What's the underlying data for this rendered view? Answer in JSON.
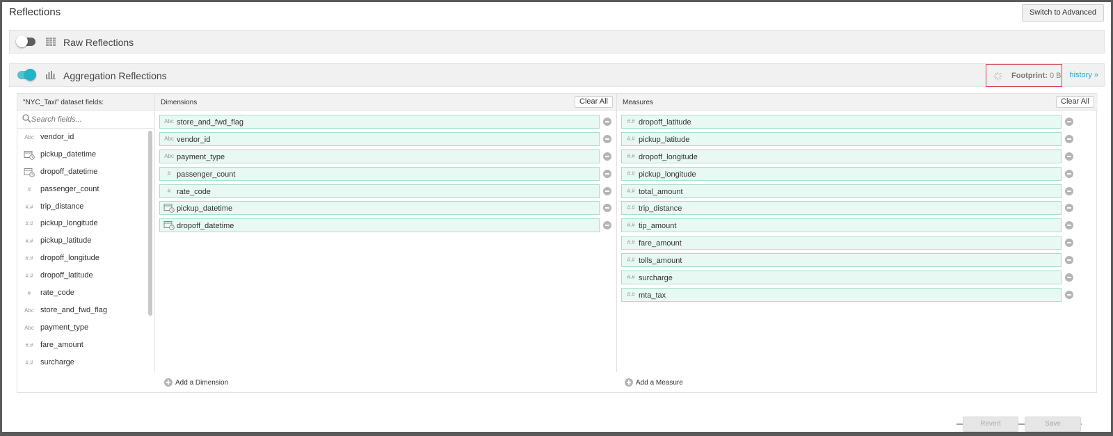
{
  "page": {
    "title": "Reflections",
    "switch_label": "Switch to Advanced"
  },
  "raw": {
    "label": "Raw Reflections",
    "enabled": false
  },
  "aggregation": {
    "label": "Aggregation Reflections",
    "enabled": true,
    "footprint_label": "Footprint:",
    "footprint_value": "0 B",
    "history_label": "history »"
  },
  "fields_panel": {
    "title": "\"NYC_Taxi\" dataset fields:",
    "search_placeholder": "Search fields...",
    "items": [
      {
        "label": "vendor_id",
        "type": "text"
      },
      {
        "label": "pickup_datetime",
        "type": "datetime"
      },
      {
        "label": "dropoff_datetime",
        "type": "datetime"
      },
      {
        "label": "passenger_count",
        "type": "integer"
      },
      {
        "label": "trip_distance",
        "type": "decimal"
      },
      {
        "label": "pickup_longitude",
        "type": "decimal"
      },
      {
        "label": "pickup_latitude",
        "type": "decimal"
      },
      {
        "label": "dropoff_longitude",
        "type": "decimal"
      },
      {
        "label": "dropoff_latitude",
        "type": "decimal"
      },
      {
        "label": "rate_code",
        "type": "integer"
      },
      {
        "label": "store_and_fwd_flag",
        "type": "text"
      },
      {
        "label": "payment_type",
        "type": "text"
      },
      {
        "label": "fare_amount",
        "type": "decimal"
      },
      {
        "label": "surcharge",
        "type": "decimal"
      }
    ]
  },
  "dimensions": {
    "title": "Dimensions",
    "clear_label": "Clear All",
    "add_label": "Add a Dimension",
    "items": [
      {
        "label": "store_and_fwd_flag",
        "type": "text"
      },
      {
        "label": "vendor_id",
        "type": "text"
      },
      {
        "label": "payment_type",
        "type": "text"
      },
      {
        "label": "passenger_count",
        "type": "integer"
      },
      {
        "label": "rate_code",
        "type": "integer"
      },
      {
        "label": "pickup_datetime",
        "type": "datetime"
      },
      {
        "label": "dropoff_datetime",
        "type": "datetime"
      }
    ]
  },
  "measures": {
    "title": "Measures",
    "clear_label": "Clear All",
    "add_label": "Add a Measure",
    "items": [
      {
        "label": "dropoff_latitude",
        "type": "decimal"
      },
      {
        "label": "pickup_latitude",
        "type": "decimal"
      },
      {
        "label": "dropoff_longitude",
        "type": "decimal"
      },
      {
        "label": "pickup_longitude",
        "type": "decimal"
      },
      {
        "label": "total_amount",
        "type": "decimal"
      },
      {
        "label": "trip_distance",
        "type": "decimal"
      },
      {
        "label": "tip_amount",
        "type": "decimal"
      },
      {
        "label": "fare_amount",
        "type": "decimal"
      },
      {
        "label": "tolls_amount",
        "type": "decimal"
      },
      {
        "label": "surcharge",
        "type": "decimal"
      },
      {
        "label": "mta_tax",
        "type": "decimal"
      }
    ]
  },
  "footer": {
    "revert_label": "Revert",
    "save_label": "Save"
  },
  "type_icons": {
    "text": "Abc",
    "integer": "#",
    "decimal": "#.#",
    "datetime": "calendar-clock-icon"
  },
  "colors": {
    "accent": "#21b3c6",
    "chip_bg": "#e8f8f2",
    "chip_border": "#a6e0cb",
    "highlight": "#d9404d",
    "link": "#2aa8d0"
  }
}
